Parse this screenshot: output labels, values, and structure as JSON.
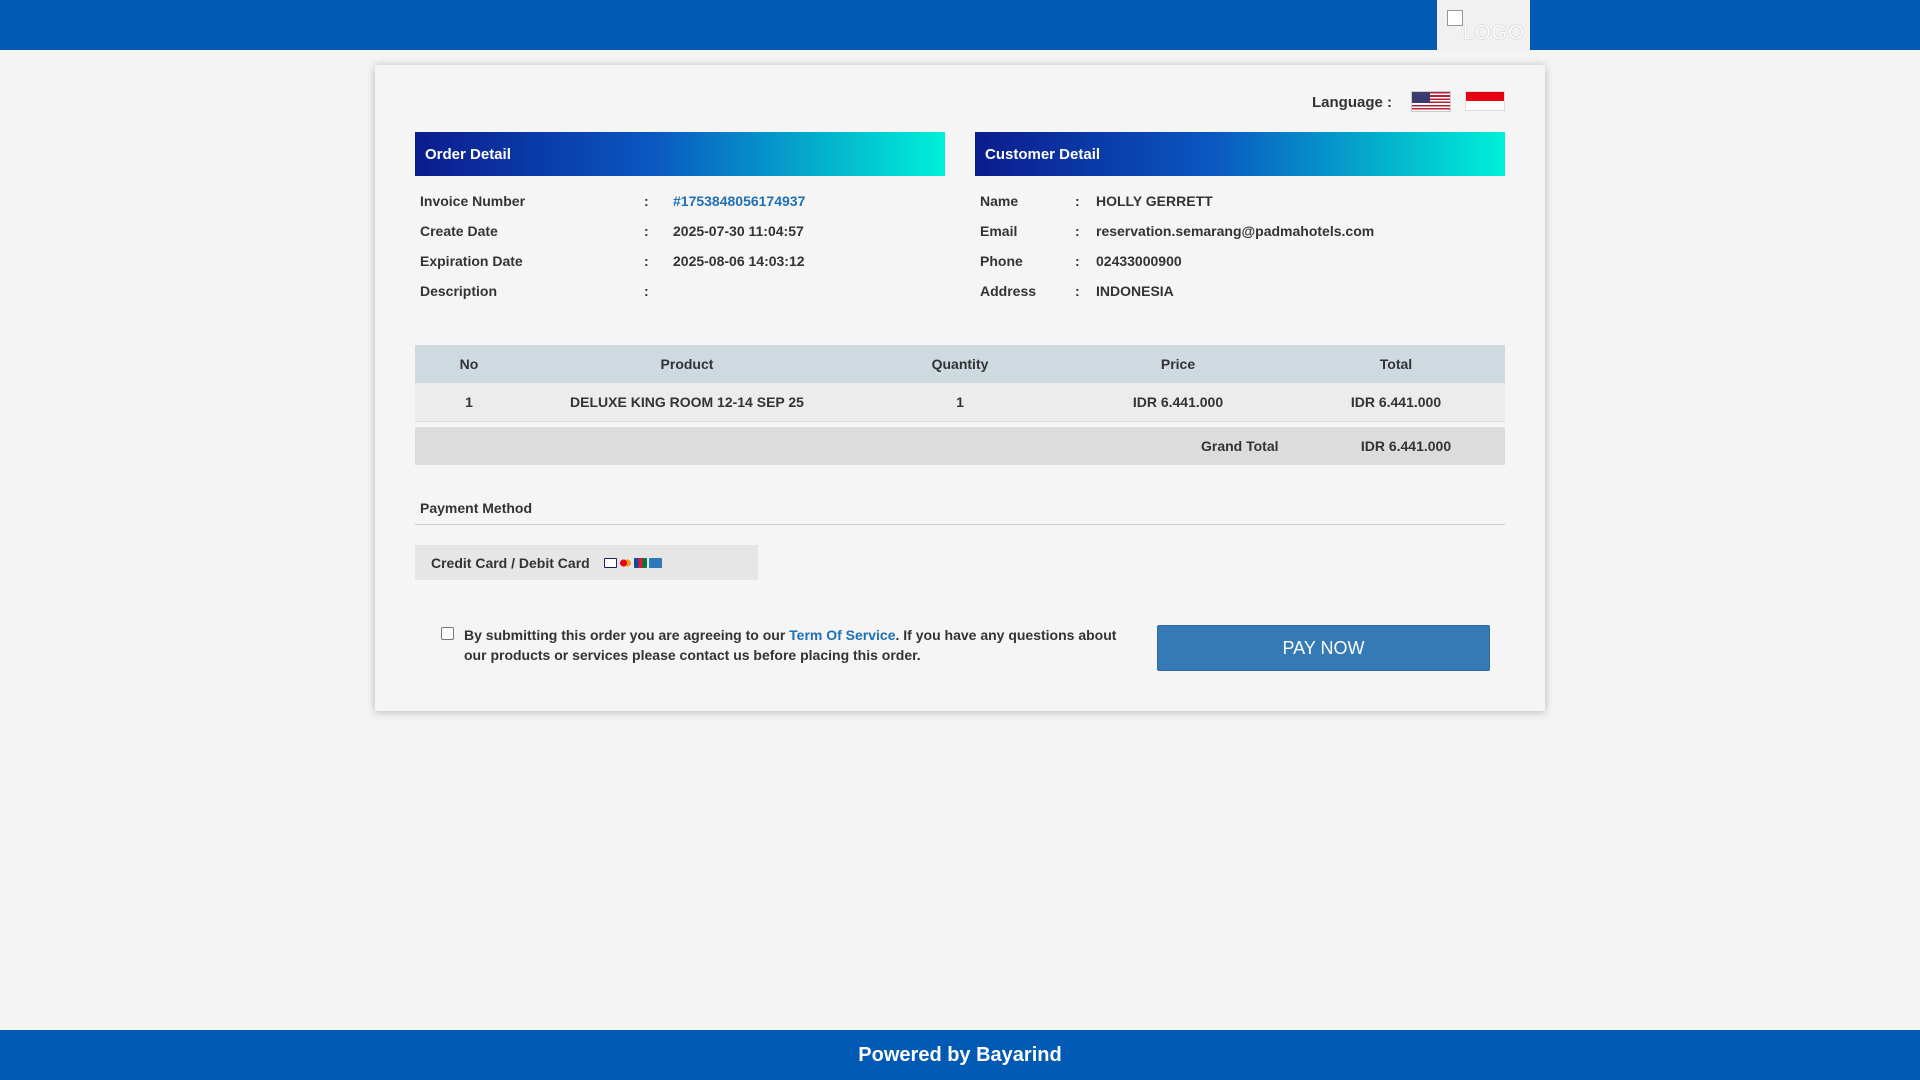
{
  "header": {
    "logo_alt": "LOGO"
  },
  "language": {
    "label": "Language :",
    "options": [
      "us-flag-icon",
      "id-flag-icon"
    ]
  },
  "order_detail": {
    "title": "Order Detail",
    "rows": [
      {
        "label": "Invoice Number",
        "value": "#1753848056174937"
      },
      {
        "label": "Create Date",
        "value": "2025-07-30 11:04:57"
      },
      {
        "label": "Expiration Date",
        "value": "2025-08-06 14:03:12"
      },
      {
        "label": "Description",
        "value": ""
      }
    ]
  },
  "customer_detail": {
    "title": "Customer Detail",
    "rows": [
      {
        "label": "Name",
        "value": "HOLLY GERRETT"
      },
      {
        "label": "Email",
        "value": "reservation.semarang@padmahotels.com"
      },
      {
        "label": "Phone",
        "value": "02433000900"
      },
      {
        "label": "Address",
        "value": "INDONESIA"
      }
    ]
  },
  "items": {
    "headers": [
      "No",
      "Product",
      "Quantity",
      "Price",
      "Total"
    ],
    "rows": [
      [
        "1",
        "DELUXE KING ROOM 12-14 SEP 25",
        "1",
        "IDR 6.441.000",
        "IDR 6.441.000"
      ]
    ],
    "grand_total_label": "Grand Total",
    "grand_total_value": "IDR 6.441.000"
  },
  "payment": {
    "title": "Payment Method",
    "option_label": "Credit Card / Debit Card"
  },
  "terms": {
    "prefix": "By submitting this order you are agreeing to our ",
    "link": "Term Of Service",
    "suffix": ". If you have any questions about our products or services please contact us before placing this order."
  },
  "pay_button": "PAY NOW",
  "footer": "Powered by Bayarind",
  "colors": {
    "brand_blue": "#0059b3",
    "button_blue": "#337ab7",
    "gradient_start": "#0b1c8e",
    "gradient_end": "#00f0d8"
  }
}
